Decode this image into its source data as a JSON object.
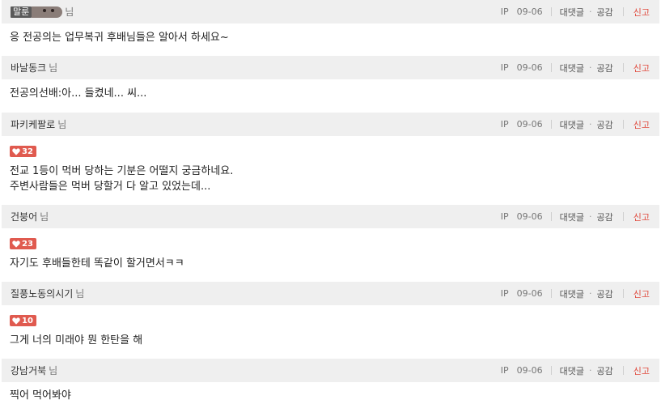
{
  "meta": {
    "ip": "IP",
    "date": "09-06",
    "reply": "대댓글",
    "dot": "·",
    "like": "공감",
    "report": "신고"
  },
  "comments": [
    {
      "author": "말룬",
      "suffix": "님",
      "has_avatar": true,
      "likes": null,
      "lines": [
        "응 전공의는 업무복귀 후배님들은 알아서 하세요~"
      ]
    },
    {
      "author": "바날동크",
      "suffix": "님",
      "likes": null,
      "lines": [
        "전공의선배:아... 들켰네... 씨..."
      ]
    },
    {
      "author": "파키케팔로",
      "suffix": "님",
      "likes": "32",
      "lines": [
        "전교 1등이 먹버 당하는 기분은 어떨지 궁금하네요.",
        "주변사람들은 먹버 당할거 다 알고 있었는데..."
      ]
    },
    {
      "author": "건붕어",
      "suffix": "님",
      "likes": "23",
      "lines": [
        "자기도 후배들한테 똑같이 할거면서ㅋㅋ"
      ]
    },
    {
      "author": "질풍노동의시기",
      "suffix": "님",
      "likes": "10",
      "lines": [
        "그게 너의 미래야 뭔 한탄을 해"
      ]
    },
    {
      "author": "강남거북",
      "suffix": "님",
      "likes": null,
      "lines": [
        "찍어 먹어봐야"
      ]
    }
  ],
  "colors": {
    "header_bg": "#efefef",
    "badge": "#e05a4f",
    "report": "#e04a3d"
  }
}
